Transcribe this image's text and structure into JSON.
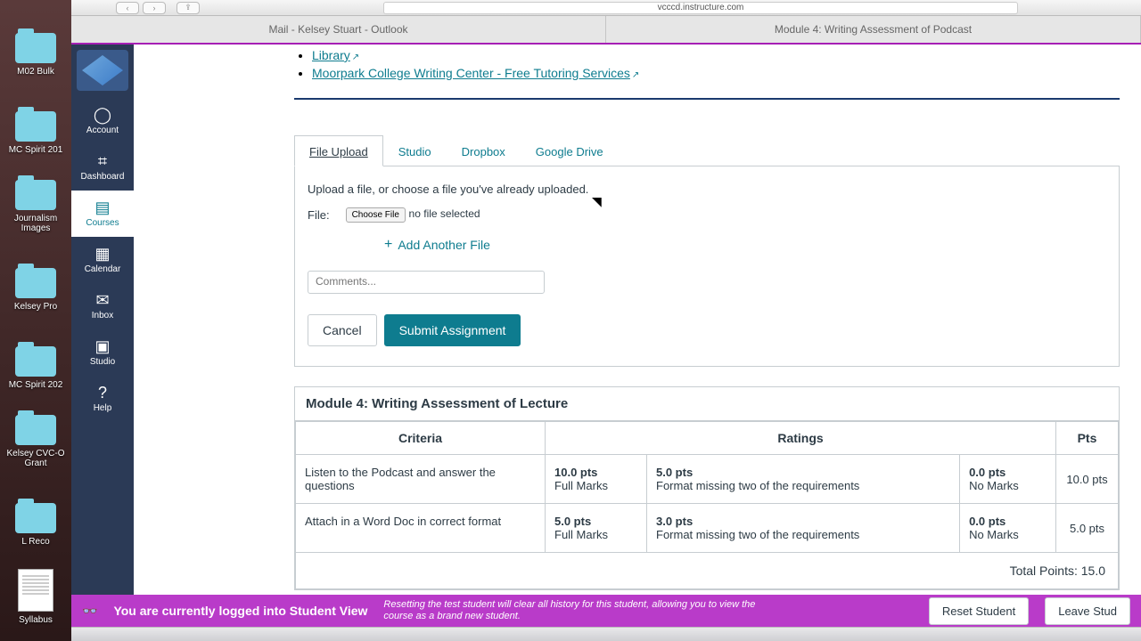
{
  "browser": {
    "url": "vcccd.instructure.com",
    "tabs": [
      "Mail - Kelsey Stuart - Outlook",
      "Module 4: Writing Assessment of Podcast"
    ]
  },
  "desktop_folders": [
    "M02 Bulk",
    "MC Spirit 201",
    "Journalism Images",
    "Kelsey Pro",
    "MC Spirit 202",
    "Kelsey CVC-O Grant",
    "L Reco",
    "Syllabus"
  ],
  "global_nav": [
    {
      "label": "Account",
      "icon": "◯"
    },
    {
      "label": "Dashboard",
      "icon": "⌗"
    },
    {
      "label": "Courses",
      "icon": "▤",
      "active": true
    },
    {
      "label": "Calendar",
      "icon": "▦"
    },
    {
      "label": "Inbox",
      "icon": "✉"
    },
    {
      "label": "Studio",
      "icon": "▣"
    },
    {
      "label": "Help",
      "icon": "?"
    }
  ],
  "links": [
    "Library",
    "Moorpark College Writing Center - Free Tutoring Services"
  ],
  "upload": {
    "tabs": [
      "File Upload",
      "Studio",
      "Dropbox",
      "Google Drive"
    ],
    "instruction": "Upload a file, or choose a file you've already uploaded.",
    "file_label": "File:",
    "choose_btn": "Choose File",
    "no_file": "no file selected",
    "add_another": "Add Another File",
    "comments_placeholder": "Comments...",
    "cancel": "Cancel",
    "submit": "Submit Assignment"
  },
  "rubric": {
    "title": "Module 4: Writing Assessment of Lecture",
    "headers": {
      "criteria": "Criteria",
      "ratings": "Ratings",
      "pts": "Pts"
    },
    "rows": [
      {
        "criteria": "Listen to the Podcast and answer the questions",
        "ratings": [
          {
            "pts": "10.0 pts",
            "label": "Full Marks"
          },
          {
            "pts": "5.0 pts",
            "label": "Format missing two of the requirements"
          },
          {
            "pts": "0.0 pts",
            "label": "No Marks"
          }
        ],
        "pts": "10.0 pts"
      },
      {
        "criteria": "Attach in a Word Doc in correct format",
        "ratings": [
          {
            "pts": "5.0 pts",
            "label": "Full Marks"
          },
          {
            "pts": "3.0 pts",
            "label": "Format missing two of the requirements"
          },
          {
            "pts": "0.0 pts",
            "label": "No Marks"
          }
        ],
        "pts": "5.0 pts"
      }
    ],
    "total": "Total Points: 15.0"
  },
  "student_view": {
    "msg": "You are currently logged into Student View",
    "desc": "Resetting the test student will clear all history for this student, allowing you to view the course as a brand new student.",
    "reset": "Reset Student",
    "leave": "Leave Stud"
  }
}
